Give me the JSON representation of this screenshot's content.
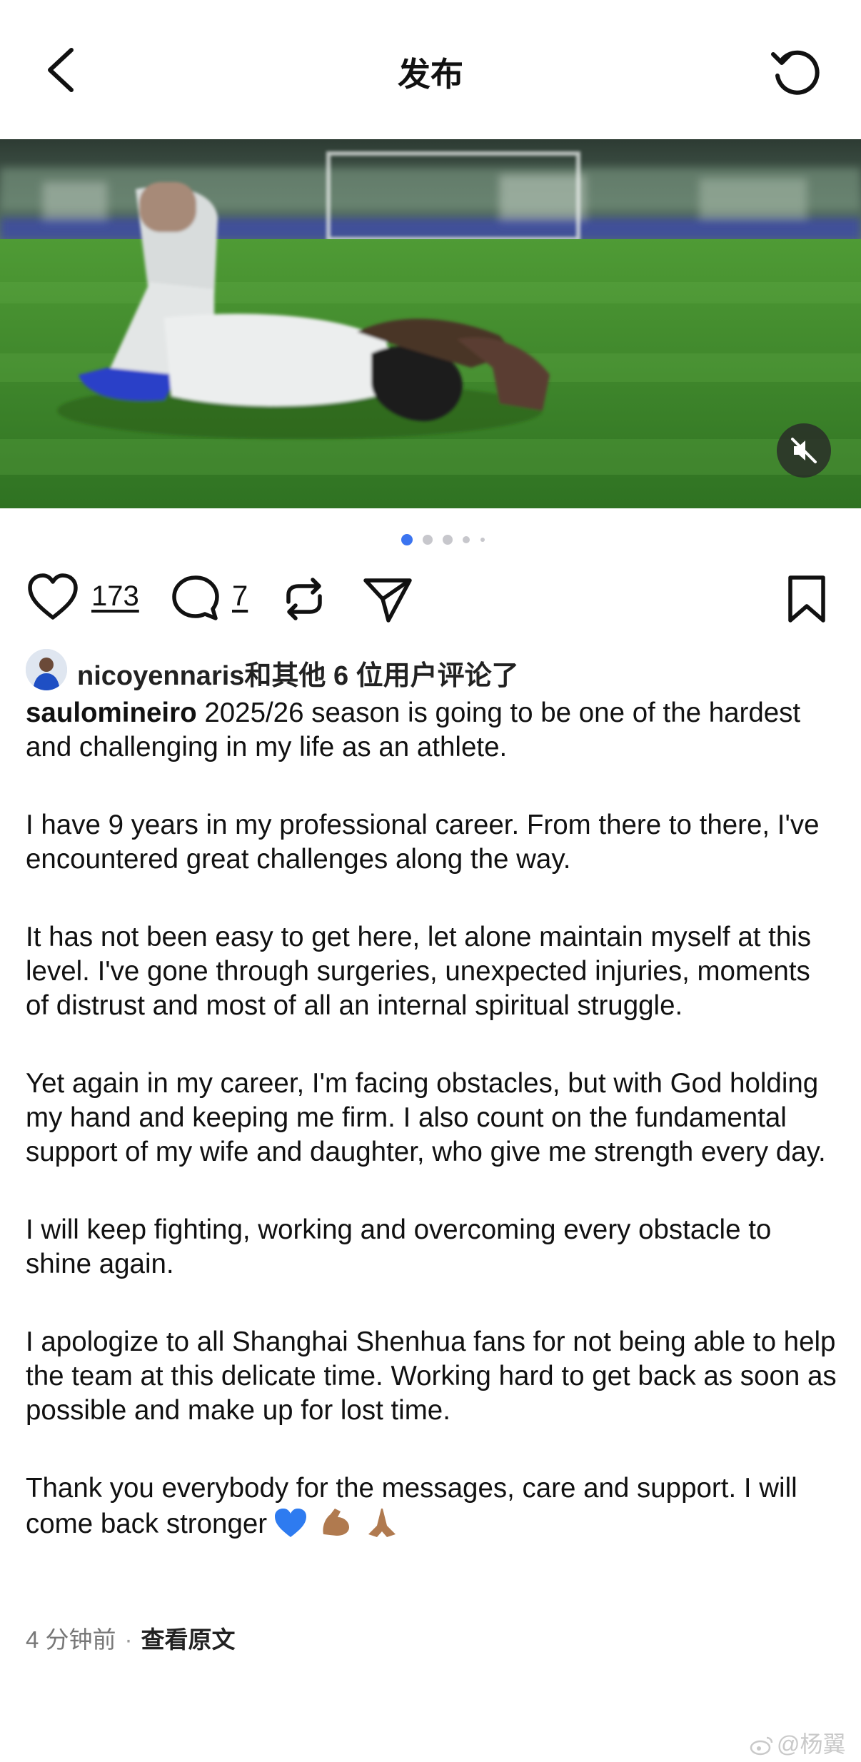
{
  "header": {
    "title": "发布"
  },
  "media": {
    "slides_total": 5,
    "active_slide": 1
  },
  "actions": {
    "like_count": "173",
    "comment_count": "7"
  },
  "comments_summary": {
    "username": "nicoyennaris",
    "rest": "和其他 6 位用户评论了"
  },
  "post": {
    "author": "saulomineiro",
    "paragraphs": [
      "2025/26 season is going to be one of the hardest and challenging in my life as an athlete.",
      "I have 9 years in my professional career. From there to there, I've encountered great challenges along the way.",
      "It has not been easy to get here, let alone maintain myself at this level. I've gone through surgeries, unexpected injuries, moments of distrust and most of all an internal spiritual struggle.",
      "Yet again in my career, I'm facing obstacles, but with God holding my hand and keeping me firm. I also count on the fundamental support of my wife and daughter, who give me strength every day.",
      "I will keep fighting, working and overcoming every obstacle to shine again.",
      "I apologize to all Shanghai Shenhua fans for not being able to help the team at this delicate time. Working hard to get back as soon as possible and make up for lost time.",
      "Thank you everybody for the messages, care and support. I will come back stronger"
    ],
    "emojis": [
      "blue-heart",
      "flexed-biceps",
      "folded-hands"
    ]
  },
  "meta": {
    "time": "4 分钟前",
    "separator": "·",
    "view_original": "查看原文"
  },
  "watermark": "@杨翼",
  "colors": {
    "accent_dot": "#3b74f0",
    "inactive_dot": "#c7c7cc",
    "pitch_green": "#3d8a2c"
  }
}
